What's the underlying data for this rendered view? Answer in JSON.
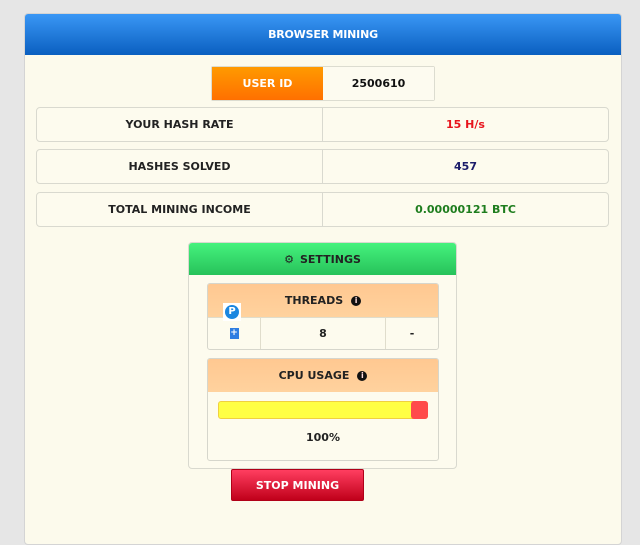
{
  "header": {
    "title": "BROWSER MINING"
  },
  "user": {
    "label": "USER ID",
    "value": "2500610"
  },
  "stats": [
    {
      "label": "YOUR HASH RATE",
      "value": "15 H/s",
      "color": "#e8141c"
    },
    {
      "label": "HASHES SOLVED",
      "value": "457",
      "color": "#1c1c6a"
    },
    {
      "label": "TOTAL MINING INCOME",
      "value": "0.00000121 BTC",
      "color": "#1e7d1e"
    }
  ],
  "settings": {
    "title": "SETTINGS",
    "gear_icon": "⚙",
    "threads": {
      "label": "THREADS",
      "info_icon": "i",
      "plus_label": "+",
      "value": "8",
      "minus_label": "-",
      "badge_icon": "P"
    },
    "cpu": {
      "label": "CPU USAGE",
      "info_icon": "i",
      "percent": 100,
      "percent_label": "100%"
    }
  },
  "actions": {
    "stop_label": "STOP MINING"
  }
}
